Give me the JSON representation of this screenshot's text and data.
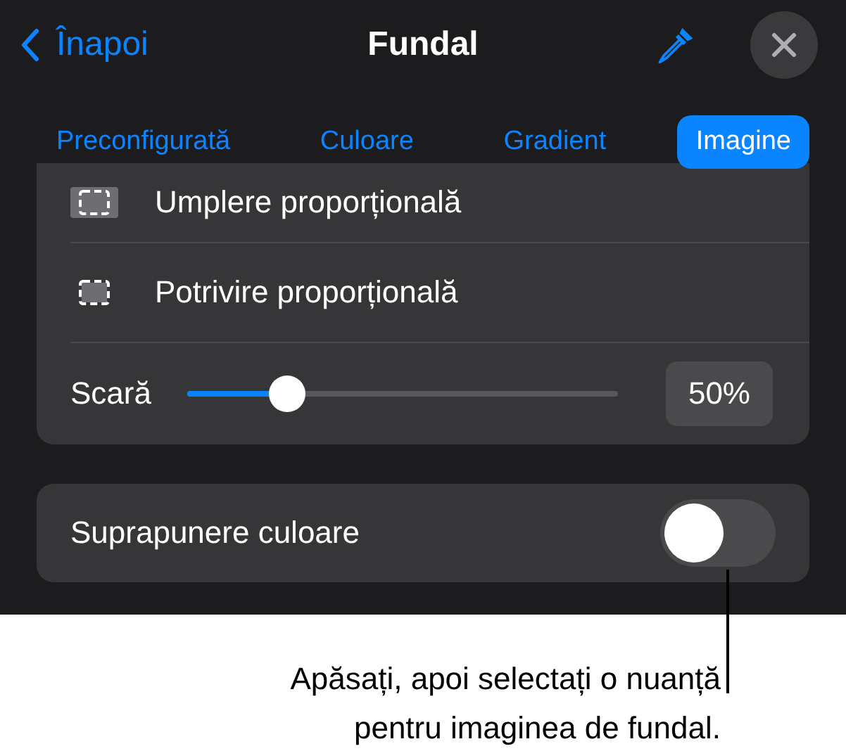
{
  "header": {
    "back": "Înapoi",
    "title": "Fundal"
  },
  "tabs": [
    {
      "label": "Preconfigurată",
      "selected": false
    },
    {
      "label": "Culoare",
      "selected": false
    },
    {
      "label": "Gradient",
      "selected": false
    },
    {
      "label": "Imagine",
      "selected": true
    }
  ],
  "options": [
    {
      "kind": "fill",
      "label": "Umplere proporțională"
    },
    {
      "kind": "fit",
      "label": "Potrivire proporțională"
    }
  ],
  "scale": {
    "label": "Scară",
    "level": 0.23,
    "reading": "50%"
  },
  "overlay": {
    "label": "Suprapunere culoare",
    "on": false
  },
  "callout": "Apăsați, apoi selectați o nuanță\npentru imaginea de fundal."
}
